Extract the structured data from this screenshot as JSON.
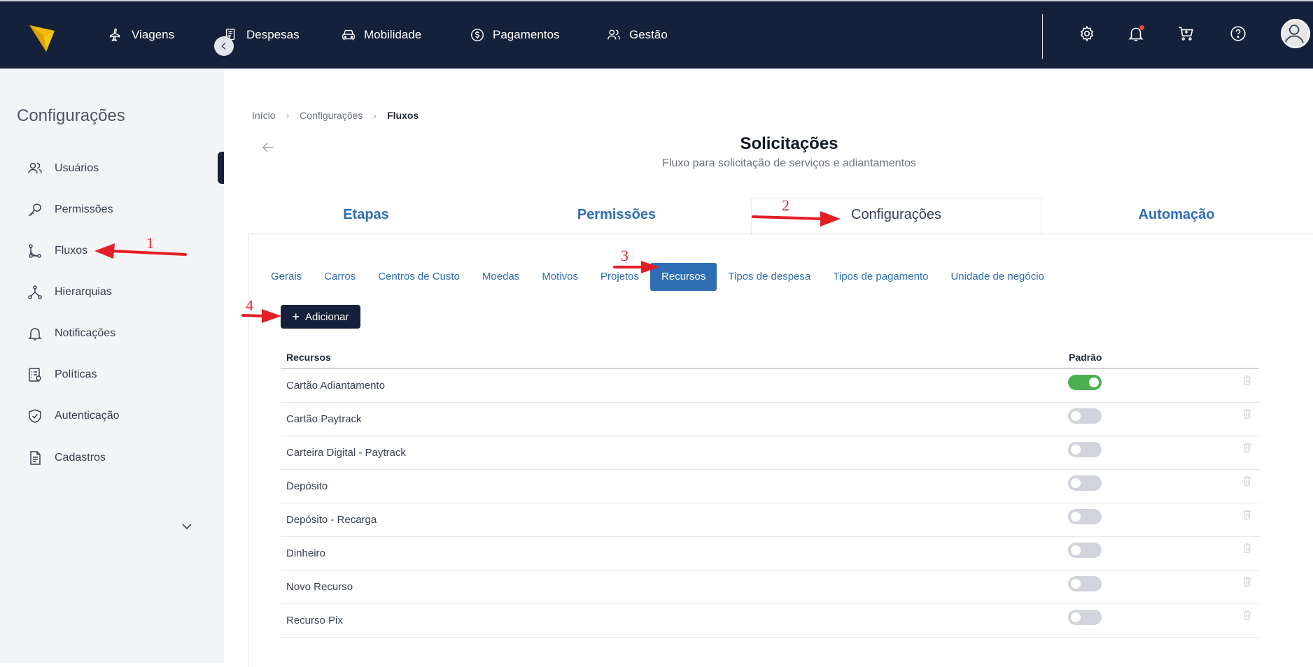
{
  "topbar": {
    "nav": [
      {
        "label": "Viagens",
        "icon": "airplane-icon"
      },
      {
        "label": "Despesas",
        "icon": "receipt-icon"
      },
      {
        "label": "Mobilidade",
        "icon": "car-icon"
      },
      {
        "label": "Pagamentos",
        "icon": "dollar-icon"
      },
      {
        "label": "Gestão",
        "icon": "users-icon"
      }
    ],
    "icons": [
      "gear-icon",
      "bell-icon",
      "cart-icon",
      "help-icon"
    ],
    "avatar_icon": "user-avatar-icon",
    "background": "#15213a"
  },
  "sidebar": {
    "title": "Configurações",
    "items": [
      {
        "label": "Usuários",
        "icon": "users-icon"
      },
      {
        "label": "Permissões",
        "icon": "key-icon"
      },
      {
        "label": "Fluxos",
        "icon": "flow-icon"
      },
      {
        "label": "Hierarquias",
        "icon": "hierarchy-icon"
      },
      {
        "label": "Notificações",
        "icon": "bell-icon"
      },
      {
        "label": "Políticas",
        "icon": "policy-icon"
      },
      {
        "label": "Autenticação",
        "icon": "shield-icon"
      },
      {
        "label": "Cadastros",
        "icon": "document-icon"
      }
    ],
    "background": "#f3f4f6"
  },
  "breadcrumb": [
    "Início",
    "Configurações",
    "Fluxos"
  ],
  "page": {
    "title": "Solicitações",
    "subtitle": "Fluxo para solicitação de serviços e adiantamentos"
  },
  "main_tabs": [
    {
      "label": "Etapas",
      "active": false
    },
    {
      "label": "Permissões",
      "active": false
    },
    {
      "label": "Configurações",
      "active": true
    },
    {
      "label": "Automação",
      "active": false
    }
  ],
  "sub_tabs": [
    {
      "label": "Gerais",
      "active": false
    },
    {
      "label": "Carros",
      "active": false
    },
    {
      "label": "Centros de Custo",
      "active": false
    },
    {
      "label": "Moedas",
      "active": false
    },
    {
      "label": "Motivos",
      "active": false
    },
    {
      "label": "Projetos",
      "active": false
    },
    {
      "label": "Recursos",
      "active": true
    },
    {
      "label": "Tipos de despesa",
      "active": false
    },
    {
      "label": "Tipos de pagamento",
      "active": false
    },
    {
      "label": "Unidade de negócio",
      "active": false
    }
  ],
  "add_button": {
    "label": "Adicionar"
  },
  "table": {
    "columns": [
      "Recursos",
      "Padrão"
    ],
    "rows": [
      {
        "name": "Cartão Adiantamento",
        "default": true
      },
      {
        "name": "Cartão Paytrack",
        "default": false
      },
      {
        "name": "Carteira Digital - Paytrack",
        "default": false
      },
      {
        "name": "Depósito",
        "default": false
      },
      {
        "name": "Depósito - Recarga",
        "default": false
      },
      {
        "name": "Dinheiro",
        "default": false
      },
      {
        "name": "Novo Recurso",
        "default": false
      },
      {
        "name": "Recurso Pix",
        "default": false
      }
    ]
  },
  "annotations": [
    "1",
    "2",
    "3",
    "4"
  ],
  "colors": {
    "accent": "#2f6db5",
    "annotation": "#e31e24",
    "toggle_on": "#4caf50"
  }
}
